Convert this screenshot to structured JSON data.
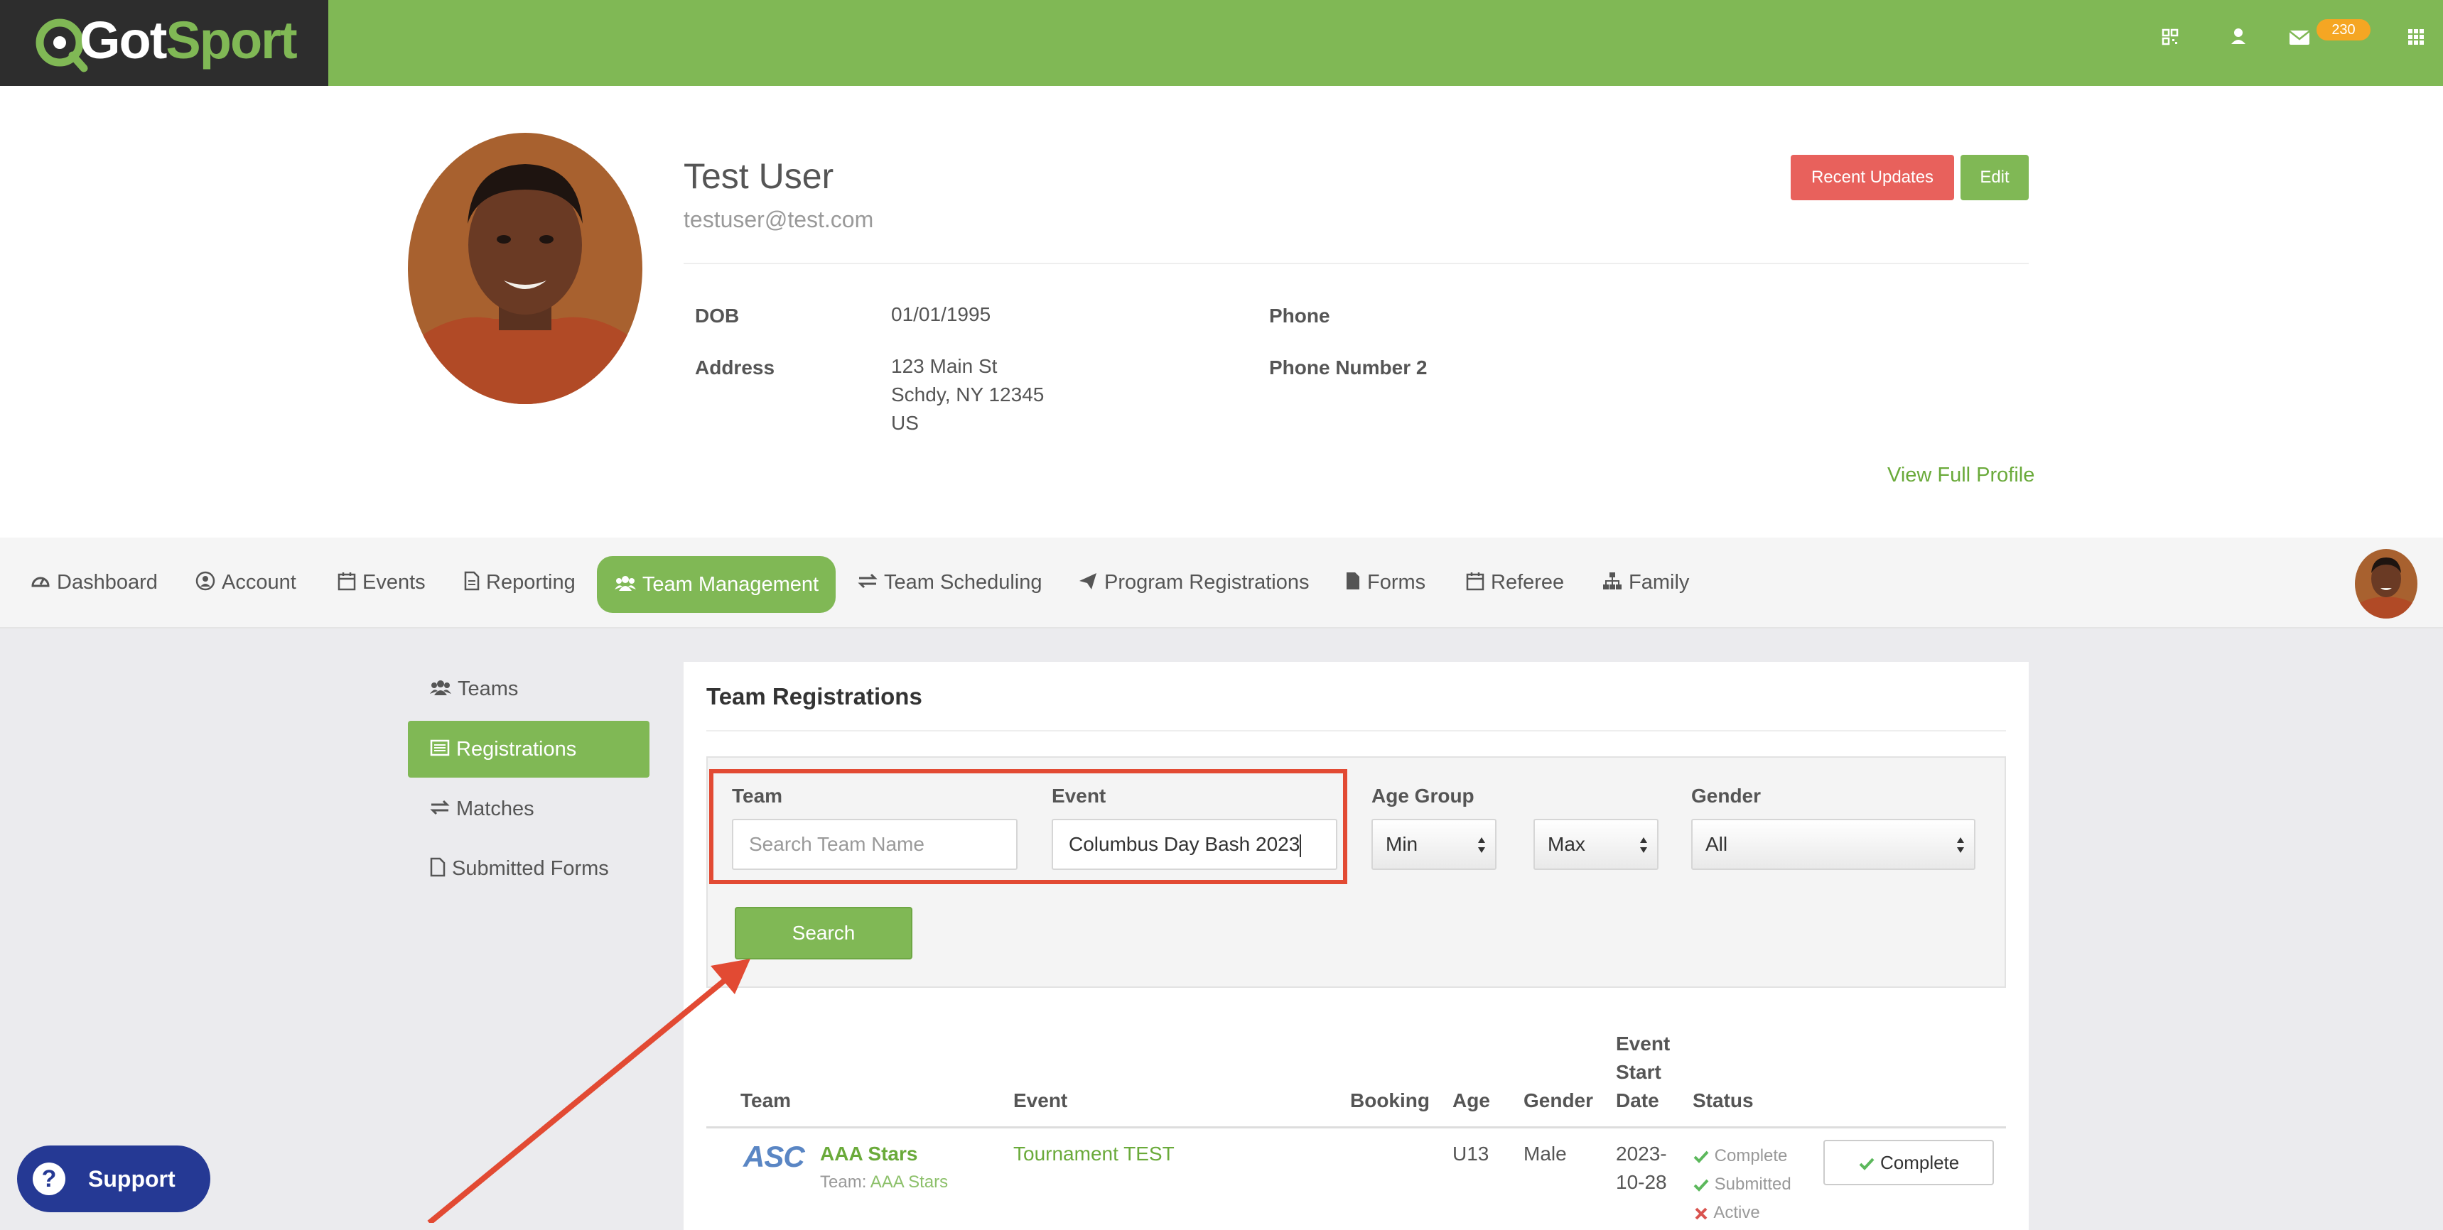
{
  "brand": {
    "logo_got": "Got",
    "logo_sport": "Sport"
  },
  "topbar": {
    "mail_badge": "230",
    "icons": [
      "qr-code-icon",
      "user-icon",
      "envelope-icon",
      "apps-grid-icon"
    ]
  },
  "profile": {
    "name": "Test User",
    "email": "testuser@test.com",
    "recent_updates_label": "Recent Updates",
    "edit_label": "Edit",
    "dob_label": "DOB",
    "dob_value": "01/01/1995",
    "address_label": "Address",
    "address_line1": "123 Main St",
    "address_line2": "Schdy, NY 12345",
    "address_line3": "US",
    "phone_label": "Phone",
    "phone2_label": "Phone Number 2",
    "view_full_label": "View Full Profile"
  },
  "nav": {
    "dashboard": "Dashboard",
    "account": "Account",
    "events": "Events",
    "reporting": "Reporting",
    "team_management": "Team Management",
    "team_scheduling": "Team Scheduling",
    "program_registrations": "Program Registrations",
    "forms": "Forms",
    "referee": "Referee",
    "family": "Family"
  },
  "sidebar": {
    "teams": "Teams",
    "registrations": "Registrations",
    "matches": "Matches",
    "submitted_forms": "Submitted Forms"
  },
  "main": {
    "title": "Team Registrations",
    "filters": {
      "team_label": "Team",
      "team_placeholder": "Search Team Name",
      "event_label": "Event",
      "event_value": "Columbus Day Bash 2023",
      "age_group_label": "Age Group",
      "age_min": "Min",
      "age_max": "Max",
      "gender_label": "Gender",
      "gender_value": "All",
      "search_label": "Search"
    },
    "table": {
      "headers": {
        "team": "Team",
        "event": "Event",
        "booking": "Booking",
        "age": "Age",
        "gender": "Gender",
        "start_line1": "Event",
        "start_line2": "Start",
        "start_line3": "Date",
        "status": "Status"
      },
      "rows": [
        {
          "logo": "ASC",
          "team": "AAA Stars",
          "team_sub_prefix": "Team:",
          "team_sub": "AAA Stars",
          "event": "Tournament TEST",
          "age": "U13",
          "gender": "Male",
          "date_line1": "2023-",
          "date_line2": "10-28",
          "status_1": "Complete",
          "status_2": "Submitted",
          "status_3": "Active",
          "action": "Complete"
        }
      ]
    }
  },
  "support": {
    "label": "Support"
  },
  "colors": {
    "brand_green": "#80b855",
    "dark": "#2d2d2d",
    "danger": "#e8615c",
    "annotation_red": "#e24a33",
    "support_blue": "#253994"
  }
}
